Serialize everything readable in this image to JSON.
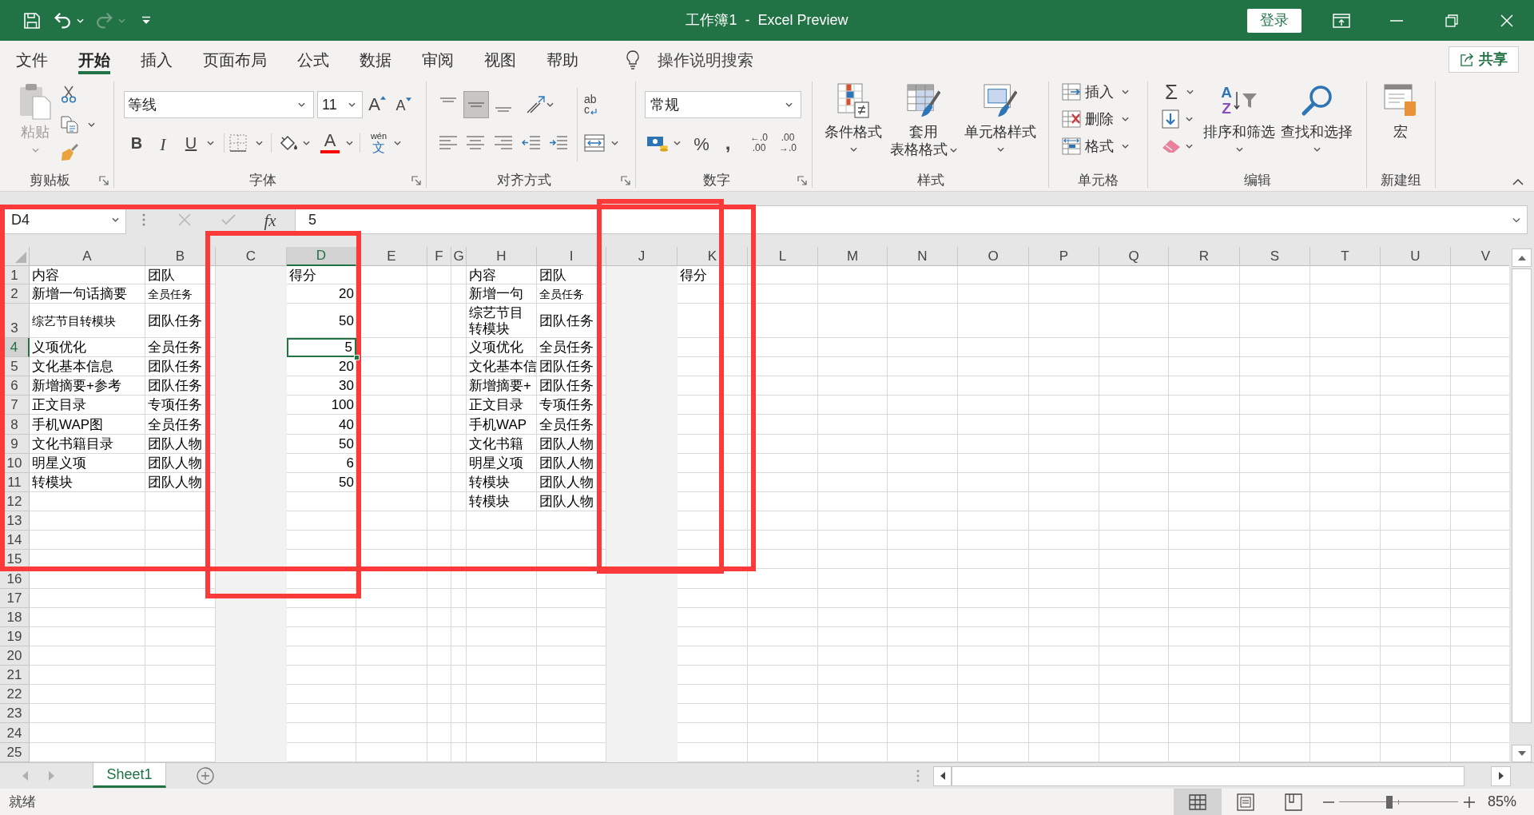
{
  "title_bar": {
    "title": "工作簿1  -  Excel Preview",
    "sign_in": "登录"
  },
  "quick_access": [
    {
      "kind": "save",
      "disabled": false
    },
    {
      "kind": "undo",
      "disabled": false
    },
    {
      "kind": "redo",
      "disabled": true
    },
    {
      "kind": "customize",
      "disabled": false
    }
  ],
  "tabs": [
    {
      "label": "文件",
      "selected": false
    },
    {
      "label": "开始",
      "selected": true
    },
    {
      "label": "插入",
      "selected": false
    },
    {
      "label": "页面布局",
      "selected": false
    },
    {
      "label": "公式",
      "selected": false
    },
    {
      "label": "数据",
      "selected": false
    },
    {
      "label": "审阅",
      "selected": false
    },
    {
      "label": "视图",
      "selected": false
    },
    {
      "label": "帮助",
      "selected": false
    }
  ],
  "tell_me": "操作说明搜索",
  "share": "共享",
  "ribbon": {
    "clipboard": {
      "paste": {
        "label": "粘贴",
        "disabled": true
      },
      "label": "剪贴板"
    },
    "font": {
      "name": "等线",
      "size": "11",
      "grow": "A",
      "shrink": "A",
      "bold": "B",
      "italic": "I",
      "underline": "U",
      "font_color": "A",
      "phonetic": [
        "wén",
        "文"
      ],
      "label": "字体"
    },
    "alignment": {
      "vertical": [
        {
          "kind": "top",
          "selected": false
        },
        {
          "kind": "middle",
          "selected": true
        },
        {
          "kind": "bottom",
          "selected": false
        }
      ],
      "wrap": [
        "ab",
        "c"
      ],
      "label": "对齐方式"
    },
    "number": {
      "format": "常规",
      "percent": "%",
      "comma": ",",
      "increase_decimal": [
        "←.0",
        ".00"
      ],
      "decrease_decimal": [
        ".00",
        "→.0"
      ],
      "label": "数字"
    },
    "styles": {
      "items": [
        {
          "kind": "conditional",
          "lines": [
            "条件格式"
          ]
        },
        {
          "kind": "table",
          "lines": [
            "套用",
            "表格格式"
          ]
        },
        {
          "kind": "cell",
          "lines": [
            "单元格样式"
          ]
        }
      ],
      "label": "样式"
    },
    "cells": {
      "items": [
        {
          "kind": "insert",
          "label": "插入"
        },
        {
          "kind": "delete",
          "label": "删除"
        },
        {
          "kind": "format",
          "label": "格式"
        }
      ],
      "label": "单元格"
    },
    "editing": {
      "autosum": "Σ",
      "sort": {
        "letters": [
          "A",
          "Z"
        ],
        "label": "排序和筛选"
      },
      "find": "查找和选择",
      "label": "编辑"
    },
    "new_group": {
      "macro": "宏",
      "label": "新建组"
    }
  },
  "formula_bar": {
    "name_box": "D4",
    "buttons": [
      {
        "kind": "cancel",
        "disabled": true
      },
      {
        "kind": "enter",
        "disabled": true
      }
    ],
    "function": "fx",
    "value": "5"
  },
  "sheet": {
    "columns": [
      {
        "label": "A",
        "selected": false,
        "shaded": false
      },
      {
        "label": "B",
        "selected": false,
        "shaded": false
      },
      {
        "label": "C",
        "selected": false,
        "shaded": true
      },
      {
        "label": "D",
        "selected": true,
        "shaded": false,
        "numeric": true
      },
      {
        "label": "E",
        "selected": false,
        "shaded": false
      },
      {
        "label": "F",
        "selected": false,
        "shaded": false
      },
      {
        "label": "G",
        "selected": false,
        "shaded": false
      },
      {
        "label": "H",
        "selected": false,
        "shaded": false
      },
      {
        "label": "I",
        "selected": false,
        "shaded": false
      },
      {
        "label": "J",
        "selected": false,
        "shaded": true
      },
      {
        "label": "K",
        "selected": false,
        "shaded": false
      },
      {
        "label": "L",
        "selected": false,
        "shaded": false
      },
      {
        "label": "M",
        "selected": false,
        "shaded": false
      },
      {
        "label": "N",
        "selected": false,
        "shaded": false
      },
      {
        "label": "O",
        "selected": false,
        "shaded": false
      },
      {
        "label": "P",
        "selected": false,
        "shaded": false
      },
      {
        "label": "Q",
        "selected": false,
        "shaded": false
      },
      {
        "label": "R",
        "selected": false,
        "shaded": false
      },
      {
        "label": "S",
        "selected": false,
        "shaded": false
      },
      {
        "label": "T",
        "selected": false,
        "shaded": false
      },
      {
        "label": "U",
        "selected": false,
        "shaded": false
      },
      {
        "label": "V",
        "selected": false,
        "shaded": false
      }
    ],
    "rows": [
      {
        "header": "1",
        "selected": false,
        "heading": true,
        "cells": [
          "内容",
          "团队",
          null,
          "得分",
          null,
          null,
          null,
          "内容",
          "团队",
          null,
          "得分"
        ]
      },
      {
        "header": "2",
        "selected": false,
        "cells": [
          "新增一句话摘要",
          "全员任务",
          null,
          "20",
          null,
          null,
          null,
          "新增一句",
          "全员任务"
        ]
      },
      {
        "header": "3",
        "selected": false,
        "cells": [
          "综艺节目转模块",
          "团队任务",
          null,
          "50",
          null,
          null,
          null,
          "综艺节目转模块",
          "团队任务"
        ]
      },
      {
        "header": "4",
        "selected": true,
        "cells": [
          "义项优化",
          "全员任务",
          null,
          "5",
          null,
          null,
          null,
          "义项优化",
          "全员任务"
        ]
      },
      {
        "header": "5",
        "selected": false,
        "cells": [
          "文化基本信息",
          "团队任务",
          null,
          "20",
          null,
          null,
          null,
          "文化基本信",
          "团队任务"
        ]
      },
      {
        "header": "6",
        "selected": false,
        "cells": [
          "新增摘要+参考",
          "团队任务",
          null,
          "30",
          null,
          null,
          null,
          "新增摘要+",
          "团队任务"
        ]
      },
      {
        "header": "7",
        "selected": false,
        "cells": [
          "正文目录",
          "专项任务",
          null,
          "100",
          null,
          null,
          null,
          "正文目录",
          "专项任务"
        ]
      },
      {
        "header": "8",
        "selected": false,
        "cells": [
          "手机WAP图",
          "全员任务",
          null,
          "40",
          null,
          null,
          null,
          "手机WAP",
          "全员任务"
        ]
      },
      {
        "header": "9",
        "selected": false,
        "cells": [
          "文化书籍目录",
          "团队人物",
          null,
          "50",
          null,
          null,
          null,
          "文化书籍",
          "团队人物"
        ]
      },
      {
        "header": "10",
        "selected": false,
        "cells": [
          "明星义项",
          "团队人物",
          null,
          "6",
          null,
          null,
          null,
          "明星义项",
          "团队人物"
        ]
      },
      {
        "header": "11",
        "selected": false,
        "cells": [
          "转模块",
          "团队人物",
          null,
          "50",
          null,
          null,
          null,
          "转模块",
          "团队人物"
        ]
      },
      {
        "header": "12",
        "selected": false,
        "cells": [
          null,
          null,
          null,
          null,
          null,
          null,
          null,
          "转模块",
          "团队人物"
        ]
      },
      {
        "header": "13",
        "selected": false
      },
      {
        "header": "14",
        "selected": false
      },
      {
        "header": "15",
        "selected": false
      },
      {
        "header": "16",
        "selected": false
      },
      {
        "header": "17",
        "selected": false
      },
      {
        "header": "18",
        "selected": false
      },
      {
        "header": "19",
        "selected": false
      },
      {
        "header": "20",
        "selected": false
      },
      {
        "header": "21",
        "selected": false
      },
      {
        "header": "22",
        "selected": false
      },
      {
        "header": "23",
        "selected": false
      },
      {
        "header": "24",
        "selected": false
      },
      {
        "header": "25",
        "selected": false
      }
    ]
  },
  "sheet_tabs": {
    "nav": [
      {
        "kind": "previous",
        "disabled": true
      },
      {
        "kind": "next",
        "disabled": true
      }
    ],
    "tabs": [
      {
        "label": "Sheet1",
        "selected": true
      }
    ]
  },
  "status_bar": {
    "text": "就绪",
    "views": [
      {
        "kind": "normal",
        "selected": true
      },
      {
        "kind": "page_layout",
        "selected": false
      },
      {
        "kind": "page_break",
        "selected": false
      }
    ],
    "zoom": {
      "level": 0.42,
      "reading": "85%"
    }
  },
  "annotations": [
    {
      "kind": "frame"
    },
    {
      "kind": "frame"
    },
    {
      "kind": "frame"
    }
  ]
}
